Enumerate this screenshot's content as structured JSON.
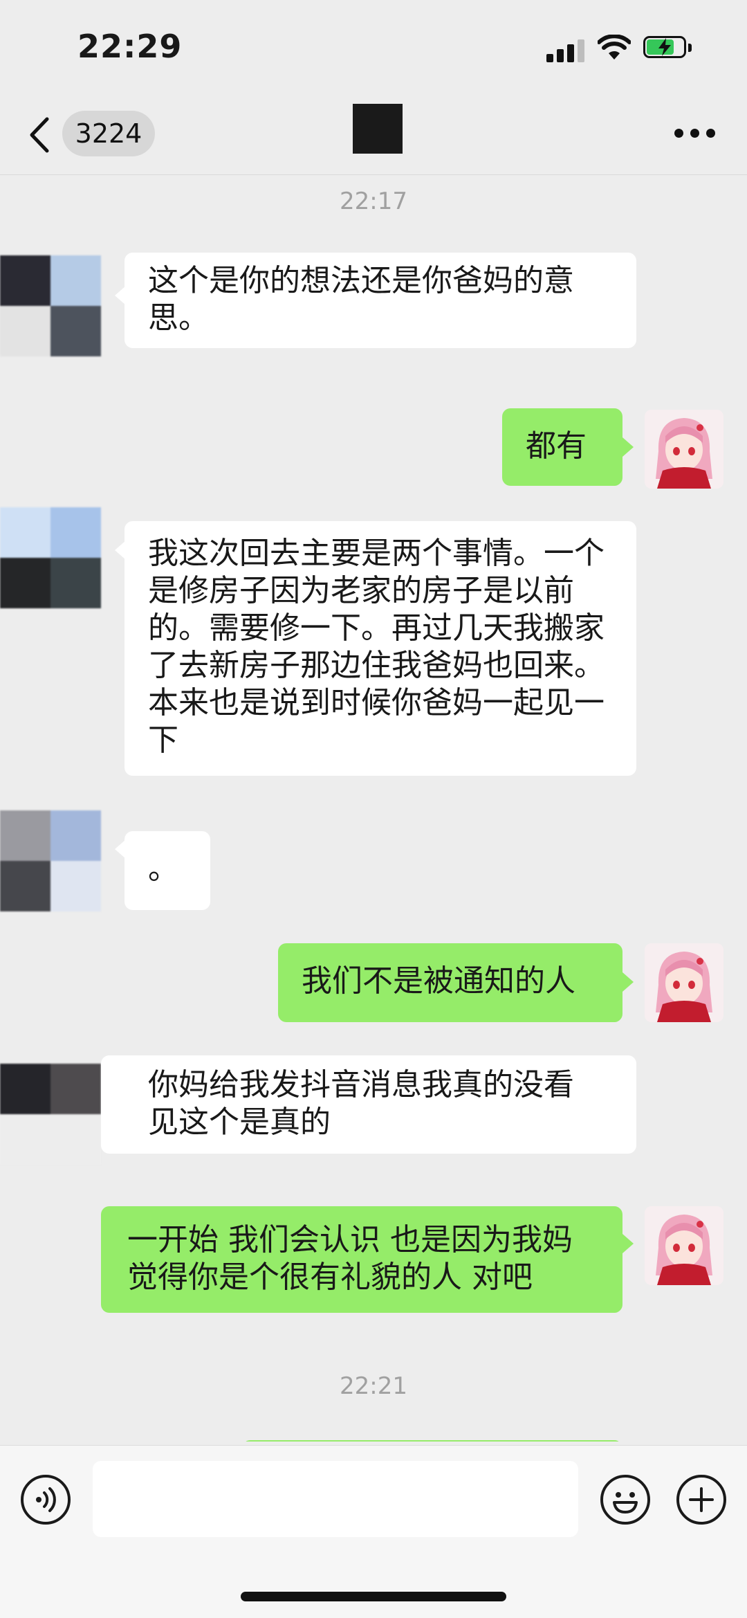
{
  "status_bar": {
    "time": "22:29",
    "battery_level": 0.75,
    "icons": [
      "cellular-signal-icon",
      "wifi-icon",
      "battery-charging-icon"
    ]
  },
  "nav": {
    "unread_count": "3224",
    "icons": [
      "back-chevron-icon",
      "more-dots-icon"
    ]
  },
  "chat": {
    "timestamps": [
      "22:17",
      "22:21"
    ],
    "messages": [
      {
        "side": "in",
        "text": "这个是你的想法还是你爸妈的意思。"
      },
      {
        "side": "out",
        "text": "都有"
      },
      {
        "side": "in",
        "text": "我这次回去主要是两个事情。一个是修房子因为老家的房子是以前的。需要修一下。再过几天我搬家了去新房子那边住我爸妈也回来。本来也是说到时候你爸妈一起见一下"
      },
      {
        "side": "in",
        "text": "。"
      },
      {
        "side": "out",
        "text": "我们不是被通知的人"
      },
      {
        "side": "in",
        "text": "你妈给我发抖音消息我真的没看见这个是真的"
      },
      {
        "side": "out",
        "text": "一开始 我们会认识 也是因为我妈觉得你是个很有礼貌的人 对吧"
      }
    ]
  },
  "input_bar": {
    "placeholder": "",
    "icons": [
      "voice-icon",
      "emoji-icon",
      "plus-icon"
    ]
  },
  "colors": {
    "background": "#ededed",
    "outgoing_bubble": "#95ec69",
    "incoming_bubble": "#ffffff",
    "timestamp": "#a0a0a0"
  }
}
